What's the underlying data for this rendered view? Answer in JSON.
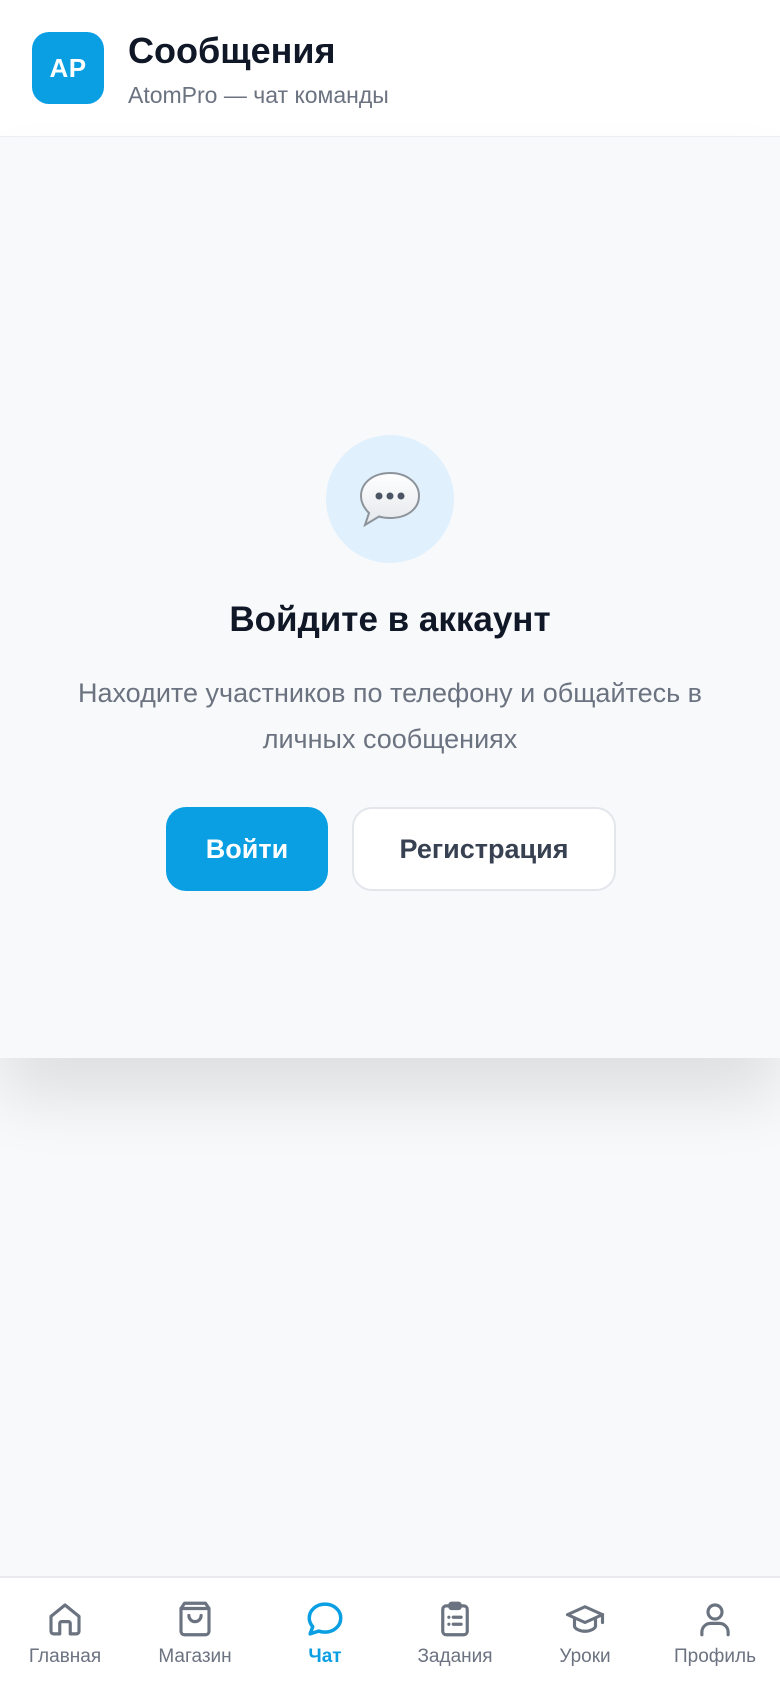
{
  "header": {
    "logo_text": "AP",
    "title": "Сообщения",
    "subtitle": "AtomPro — чат команды"
  },
  "login_prompt": {
    "icon": "speech-bubble-icon",
    "heading": "Войдите в аккаунт",
    "description": "Находите участников по телефону и общайтесь в личных сообщениях",
    "login_label": "Войти",
    "register_label": "Регистрация"
  },
  "nav": {
    "active": "Чат",
    "items": [
      {
        "label": "Главная",
        "icon": "home-icon"
      },
      {
        "label": "Магазин",
        "icon": "shopping-bag-icon"
      },
      {
        "label": "Чат",
        "icon": "chat-icon"
      },
      {
        "label": "Задания",
        "icon": "clipboard-icon"
      },
      {
        "label": "Уроки",
        "icon": "graduation-cap-icon"
      },
      {
        "label": "Профиль",
        "icon": "user-icon"
      }
    ]
  },
  "colors": {
    "accent": "#0a9fe3",
    "text_primary": "#101828",
    "text_secondary": "#6b7280"
  }
}
